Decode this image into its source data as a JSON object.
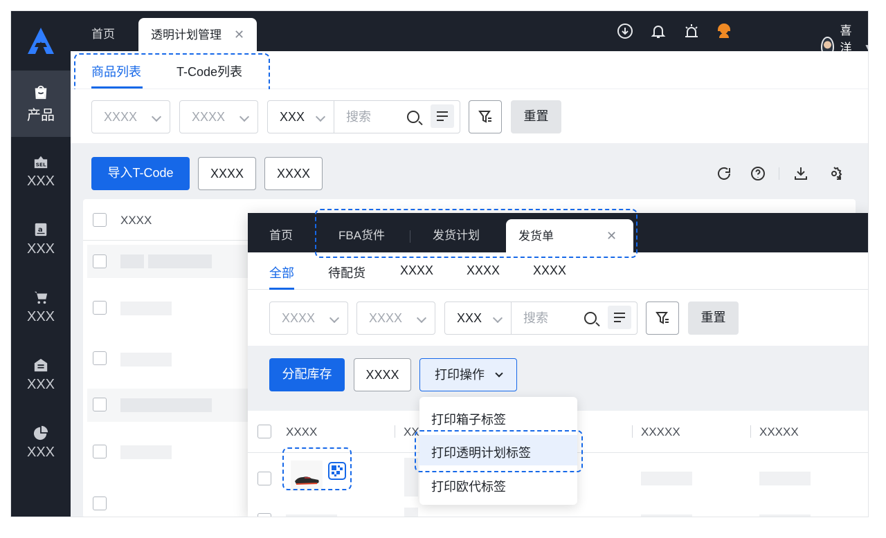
{
  "app": {
    "user_name": "喜洋洋"
  },
  "sidebar": {
    "items": [
      {
        "label": "产品",
        "icon": "shopping-bag-icon"
      },
      {
        "label": "XXX",
        "icon": "sel-tag-icon"
      },
      {
        "label": "XXX",
        "icon": "amazon-icon"
      },
      {
        "label": "XXX",
        "icon": "cart-icon"
      },
      {
        "label": "XXX",
        "icon": "warehouse-icon"
      },
      {
        "label": "XXX",
        "icon": "pie-chart-icon"
      }
    ]
  },
  "main": {
    "tabs": {
      "home": "首页",
      "active": "透明计划管理"
    },
    "subtabs": [
      "商品列表",
      "T-Code列表"
    ],
    "filters": {
      "sel1": "XXXX",
      "sel2": "XXXX",
      "sel3": "XXX",
      "search_placeholder": "搜索",
      "reset": "重置"
    },
    "actions": {
      "import": "导入T-Code",
      "btn1": "XXXX",
      "btn2": "XXXX"
    },
    "table": {
      "col1": "XXXX"
    }
  },
  "popup": {
    "tabs": {
      "home": "首页",
      "fba": "FBA货件",
      "plan": "发货计划",
      "active": "发货单"
    },
    "subtabs": [
      "全部",
      "待配货",
      "XXXX",
      "XXXX",
      "XXXX"
    ],
    "filters": {
      "sel1": "XXXX",
      "sel2": "XXXX",
      "sel3": "XXX",
      "search_placeholder": "搜索",
      "reset": "重置"
    },
    "actions": {
      "allocate": "分配库存",
      "btn1": "XXXX",
      "print": "打印操作"
    },
    "table": {
      "cols": [
        "XXXX",
        "XX",
        "XXXXX",
        "XXXXX"
      ]
    },
    "dropdown": {
      "items": [
        "打印箱子标签",
        "打印透明计划标签",
        "打印欧代标签"
      ]
    }
  },
  "colors": {
    "accent": "#1668e8",
    "sidebar": "#1d222c"
  }
}
